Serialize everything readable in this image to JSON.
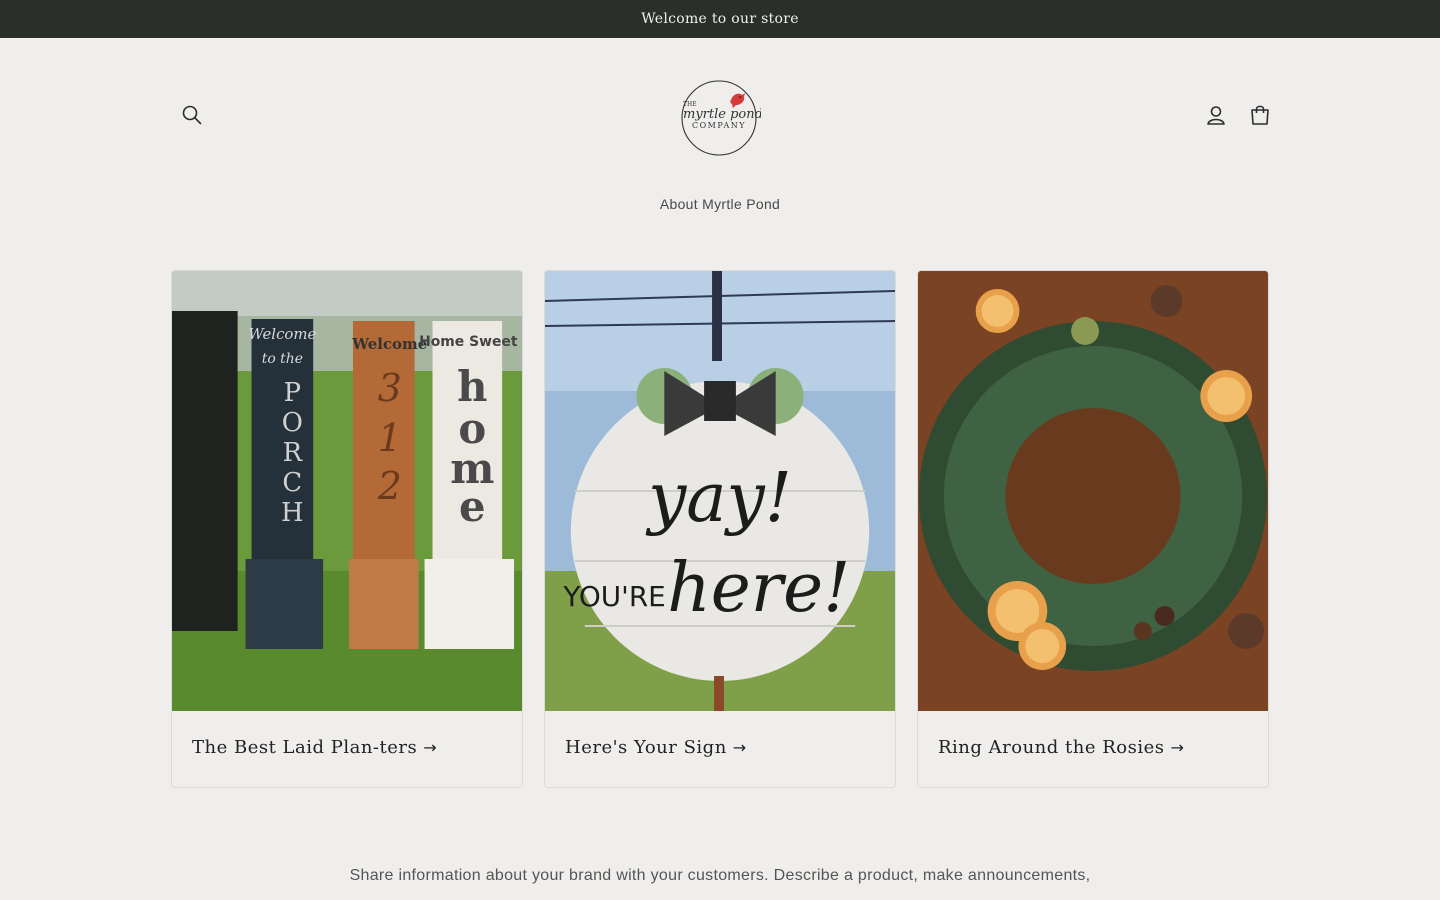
{
  "announcement": {
    "text": "Welcome to our store"
  },
  "header": {
    "search_icon": "search-icon",
    "logo": {
      "top_text": "THE",
      "script_text": "myrtle pond",
      "bottom_text": "COMPANY",
      "bird_color": "#d63a3a"
    },
    "account_icon": "account-icon",
    "cart_icon": "cart-icon"
  },
  "nav": {
    "items": [
      {
        "label": "About Myrtle Pond"
      }
    ]
  },
  "collections": [
    {
      "title": "The Best Laid Plan-ters",
      "arrow": "→"
    },
    {
      "title": "Here's Your Sign",
      "arrow": "→"
    },
    {
      "title": "Ring Around the Rosies",
      "arrow": "→"
    }
  ],
  "signs": {
    "porch_top": "Welcome",
    "porch_mid": "to the",
    "porch_letters": [
      "P",
      "O",
      "R",
      "C",
      "H"
    ],
    "number_top": "Welcome",
    "number_digits": [
      "3",
      "1",
      "2"
    ],
    "home_top": "Home Sweet",
    "home_letters": [
      "h",
      "o",
      "m",
      "e"
    ],
    "round_sign_line1": "yay!",
    "round_sign_line2a": "YOU'RE",
    "round_sign_line2b": "here!"
  },
  "description": {
    "text": "Share information about your brand with your customers. Describe a product, make announcements,"
  }
}
